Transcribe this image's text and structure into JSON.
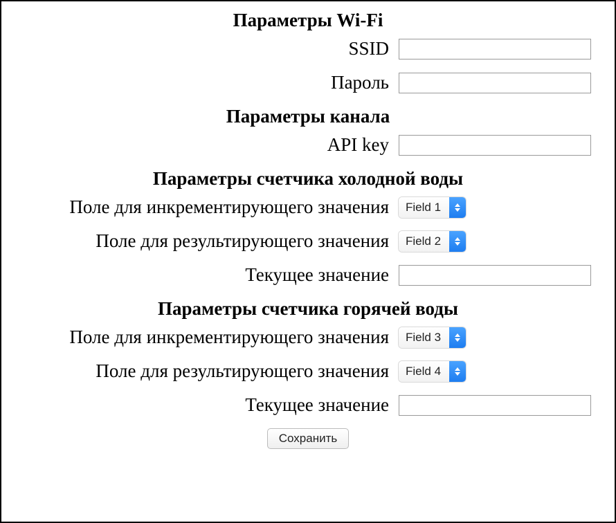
{
  "sections": {
    "wifi": {
      "heading": "Параметры Wi-Fi",
      "ssid_label": "SSID",
      "ssid_value": "",
      "password_label": "Пароль",
      "password_value": ""
    },
    "channel": {
      "heading": "Параметры канала",
      "api_key_label": "API key",
      "api_key_value": ""
    },
    "cold": {
      "heading": "Параметры счетчика холодной воды",
      "increment_label": "Поле для инкрементирующего значения",
      "increment_selected": "Field 1",
      "result_label": "Поле для результирующего значения",
      "result_selected": "Field 2",
      "current_label": "Текущее значение",
      "current_value": ""
    },
    "hot": {
      "heading": "Параметры счетчика горячей воды",
      "increment_label": "Поле для инкрементирующего значения",
      "increment_selected": "Field 3",
      "result_label": "Поле для результирующего значения",
      "result_selected": "Field 4",
      "current_label": "Текущее значение",
      "current_value": ""
    }
  },
  "submit_label": "Сохранить"
}
